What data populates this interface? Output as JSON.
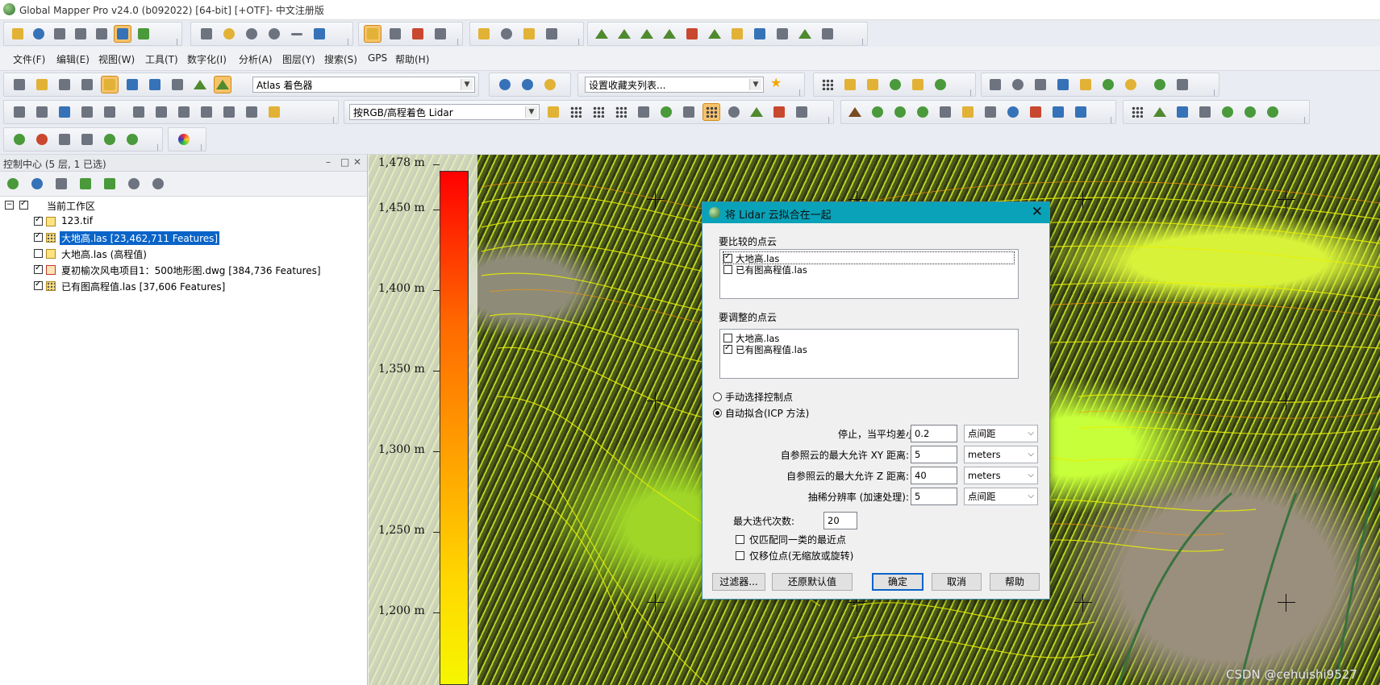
{
  "window": {
    "title": "Global Mapper Pro v24.0 (b092022) [64-bit] [+OTF]- 中文注册版"
  },
  "menubar": {
    "items": [
      "文件(F)",
      "编辑(E)",
      "视图(W)",
      "工具(T)",
      "数字化(I)",
      "分析(A)",
      "图层(Y)",
      "搜索(S)",
      "GPS",
      "帮助(H)"
    ]
  },
  "toolbar": {
    "shader_combo": "Atlas 着色器",
    "favorites_combo": "设置收藏夹列表...",
    "lidar_color_combo": "按RGB/高程着色 Lidar"
  },
  "panel": {
    "title": "控制中心 (5 层, 1 已选)",
    "workspace": "当前工作区",
    "layers": [
      {
        "label": "123.tif",
        "checked": true,
        "selected": false
      },
      {
        "label": "大地高.las [23,462,711 Features]",
        "checked": true,
        "selected": true
      },
      {
        "label": "大地高.las (高程值)",
        "checked": false,
        "selected": false
      },
      {
        "label": "夏初榆次风电项目1：500地形图.dwg [384,736 Features]",
        "checked": true,
        "selected": false
      },
      {
        "label": "已有图高程值.las [37,606 Features]",
        "checked": true,
        "selected": false
      }
    ]
  },
  "legend": {
    "ticks": [
      "1,478 m",
      "1,450 m",
      "1,400 m",
      "1,350 m",
      "1,300 m",
      "1,250 m",
      "1,200 m"
    ]
  },
  "dialog": {
    "title": "将 Lidar 云拟合在一起",
    "compare_section": "要比较的点云",
    "compare_items": [
      {
        "label": "大地高.las",
        "checked": true
      },
      {
        "label": "已有图高程值.las",
        "checked": false
      }
    ],
    "adjust_section": "要调整的点云",
    "adjust_items": [
      {
        "label": "大地高.las",
        "checked": false
      },
      {
        "label": "已有图高程值.las",
        "checked": true
      }
    ],
    "radio_manual": "手动选择控制点",
    "radio_auto": "自动拟合(ICP 方法)",
    "fields": [
      {
        "label": "停止，当平均差小于:",
        "value": "0.2",
        "unit": "点间距"
      },
      {
        "label": "自参照云的最大允许 XY 距离:",
        "value": "5",
        "unit": "meters"
      },
      {
        "label": "自参照云的最大允许 Z 距离:",
        "value": "40",
        "unit": "meters"
      },
      {
        "label": "抽稀分辨率 (加速处理):",
        "value": "5",
        "unit": "点间距"
      }
    ],
    "max_iter_label": "最大迭代次数:",
    "max_iter_value": "20",
    "opt_same_class": "仅匹配同一类的最近点",
    "opt_translate_only": "仅移位点(无缩放或旋转)",
    "buttons": {
      "filter": "过滤器...",
      "reset": "还原默认值",
      "ok": "确定",
      "cancel": "取消",
      "help": "帮助"
    }
  },
  "watermark": "CSDN @cehuishi9527"
}
